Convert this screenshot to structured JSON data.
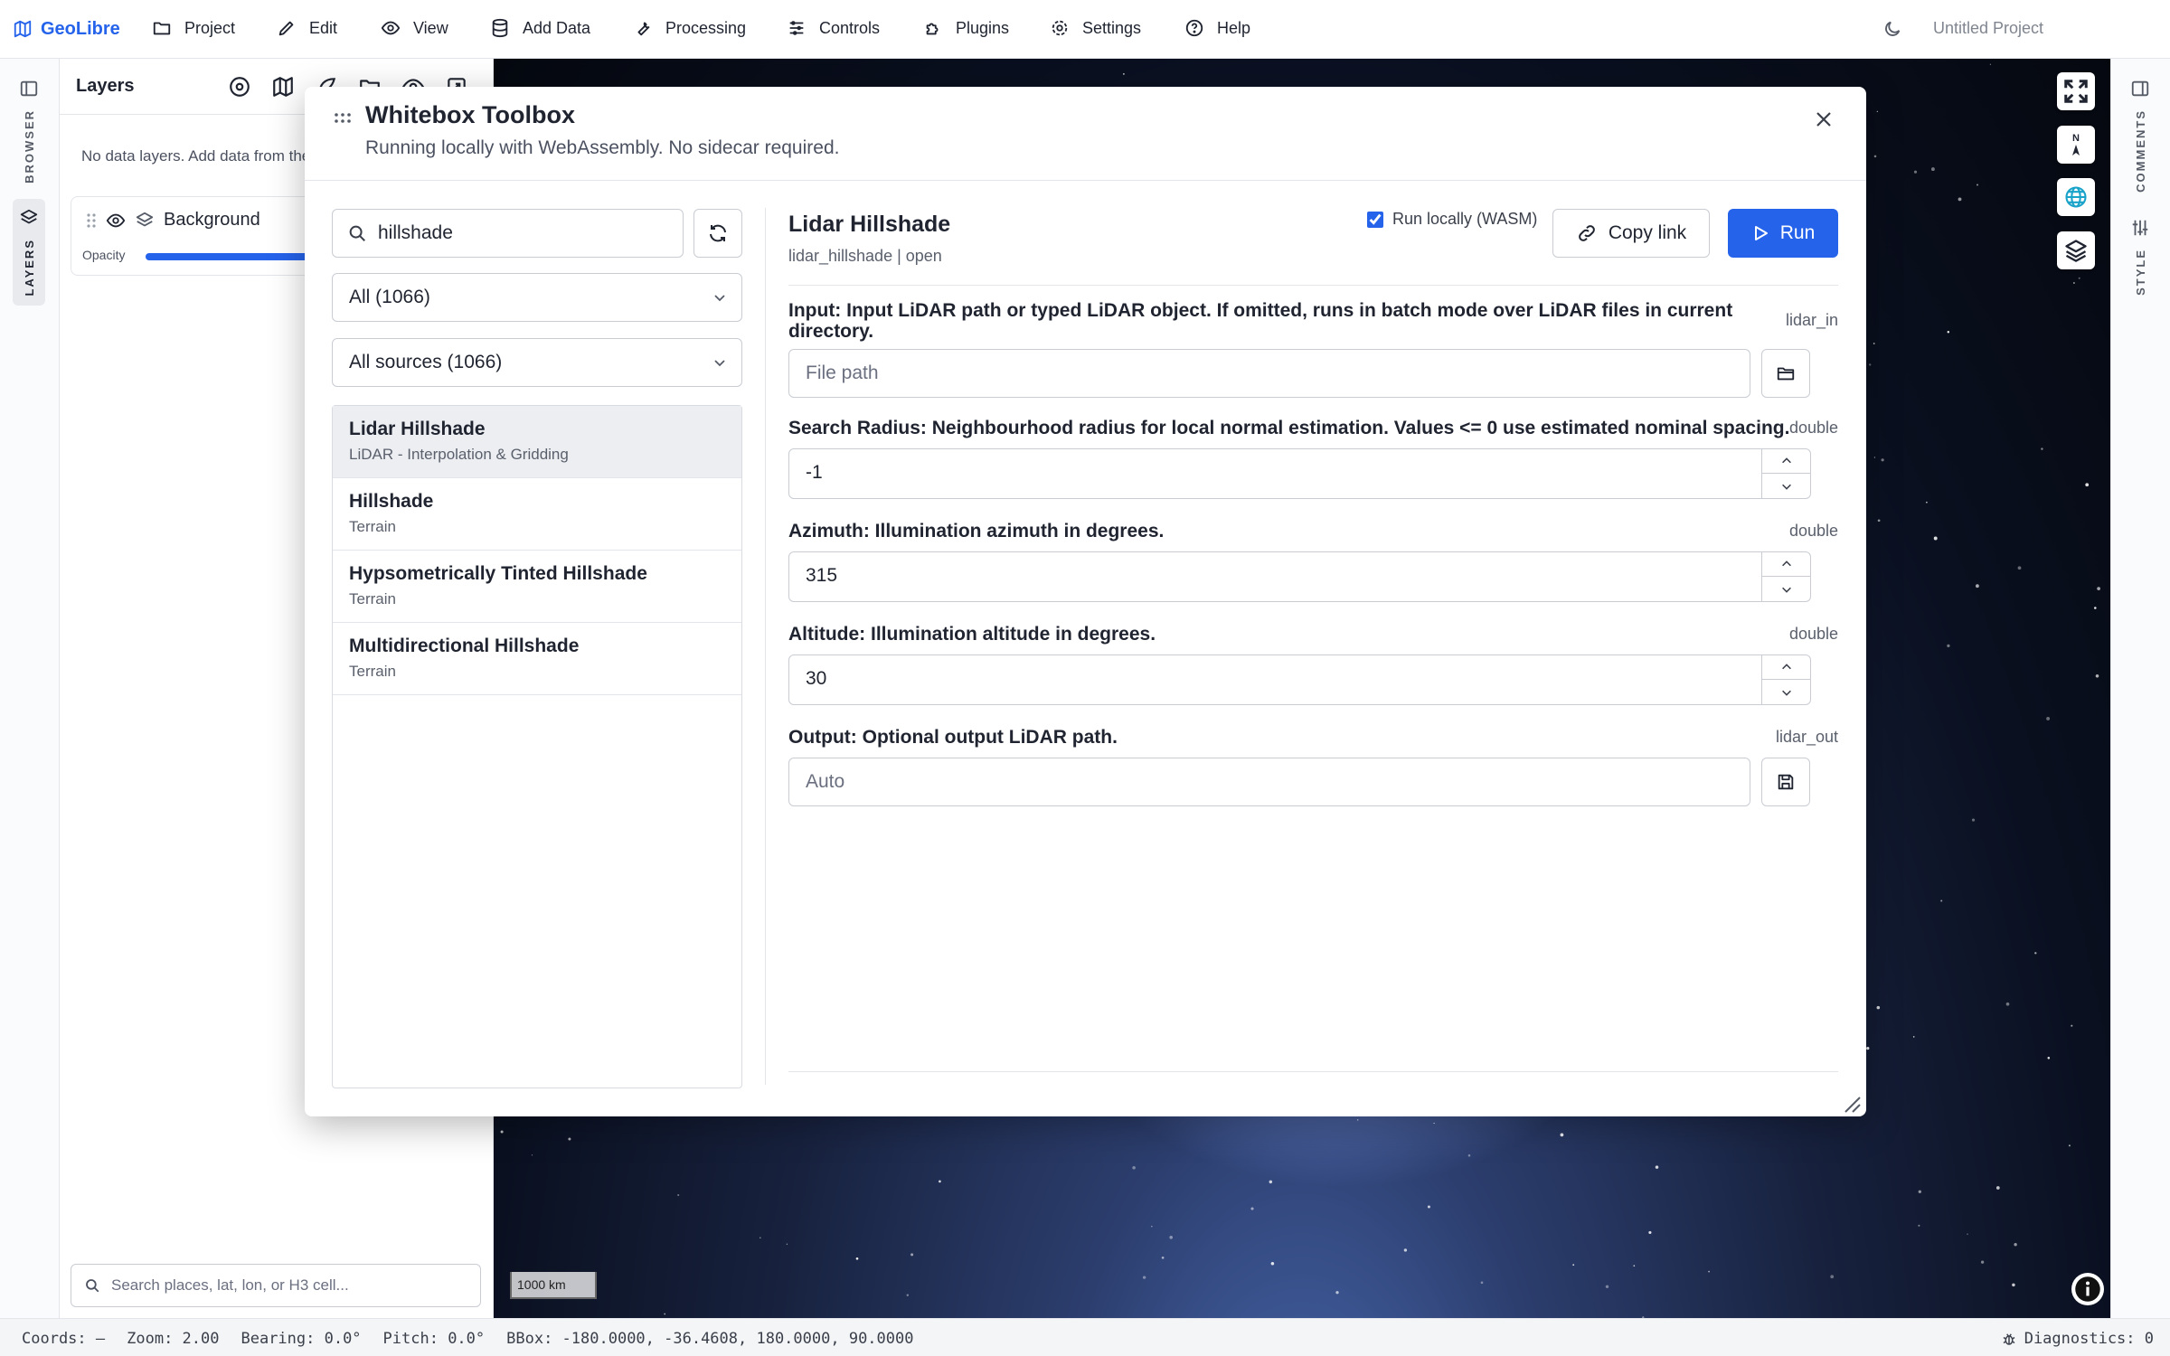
{
  "menubar": {
    "brand": "GeoLibre",
    "items": [
      {
        "label": "Project",
        "icon": "folder-icon"
      },
      {
        "label": "Edit",
        "icon": "pencil-icon"
      },
      {
        "label": "View",
        "icon": "eye-icon"
      },
      {
        "label": "Add Data",
        "icon": "database-icon"
      },
      {
        "label": "Processing",
        "icon": "wrench-icon"
      },
      {
        "label": "Controls",
        "icon": "sliders-icon"
      },
      {
        "label": "Plugins",
        "icon": "puzzle-icon"
      },
      {
        "label": "Settings",
        "icon": "gear-icon"
      },
      {
        "label": "Help",
        "icon": "help-circle-icon"
      }
    ],
    "project_title": "Untitled Project"
  },
  "activitybar": {
    "browser_label": "BROWSER",
    "layers_label": "LAYERS"
  },
  "rightbar": {
    "comments_label": "COMMENTS",
    "style_label": "STYLE"
  },
  "layers": {
    "title": "Layers",
    "empty_message": "No data layers. Add data from the",
    "background_label": "Background",
    "opacity_label": "Opacity",
    "opacity_value": 0.85,
    "search_placeholder": "Search places, lat, lon, or H3 cell..."
  },
  "map": {
    "scale_label": "1000 km",
    "compass_label": "N"
  },
  "status": {
    "coords": "Coords: —",
    "zoom": "Zoom: 2.00",
    "bearing": "Bearing: 0.0°",
    "pitch": "Pitch: 0.0°",
    "bbox": "BBox: -180.0000, -36.4608, 180.0000, 90.0000",
    "diagnostics": "Diagnostics: 0"
  },
  "dialog": {
    "title": "Whitebox Toolbox",
    "subtitle": "Running locally with WebAssembly. No sidecar required.",
    "search_value": "hillshade",
    "filter_category": "All (1066)",
    "filter_source": "All sources (1066)",
    "tools": [
      {
        "name": "Lidar Hillshade",
        "category": "LiDAR - Interpolation & Gridding"
      },
      {
        "name": "Hillshade",
        "category": "Terrain"
      },
      {
        "name": "Hypsometrically Tinted Hillshade",
        "category": "Terrain"
      },
      {
        "name": "Multidirectional Hillshade",
        "category": "Terrain"
      }
    ],
    "selected_tool": {
      "title": "Lidar Hillshade",
      "meta": "lidar_hillshade | open",
      "run_locally_label": "Run locally (WASM)",
      "run_locally_checked": true,
      "copy_link_label": "Copy link",
      "run_label": "Run"
    },
    "params": {
      "input": {
        "label": "Input: Input LiDAR path or typed LiDAR object. If omitted, runs in batch mode over LiDAR files in current directory.",
        "type": "lidar_in",
        "placeholder": "File path"
      },
      "radius": {
        "label": "Search Radius: Neighbourhood radius for local normal estimation. Values <= 0 use estimated nominal spacing.",
        "type": "double",
        "value": "-1"
      },
      "azimuth": {
        "label": "Azimuth: Illumination azimuth in degrees.",
        "type": "double",
        "value": "315"
      },
      "altitude": {
        "label": "Altitude: Illumination altitude in degrees.",
        "type": "double",
        "value": "30"
      },
      "output": {
        "label": "Output: Optional output LiDAR path.",
        "type": "lidar_out",
        "placeholder": "Auto"
      }
    }
  },
  "colors": {
    "accent": "#2563eb",
    "map_bg": "#0a1020"
  }
}
